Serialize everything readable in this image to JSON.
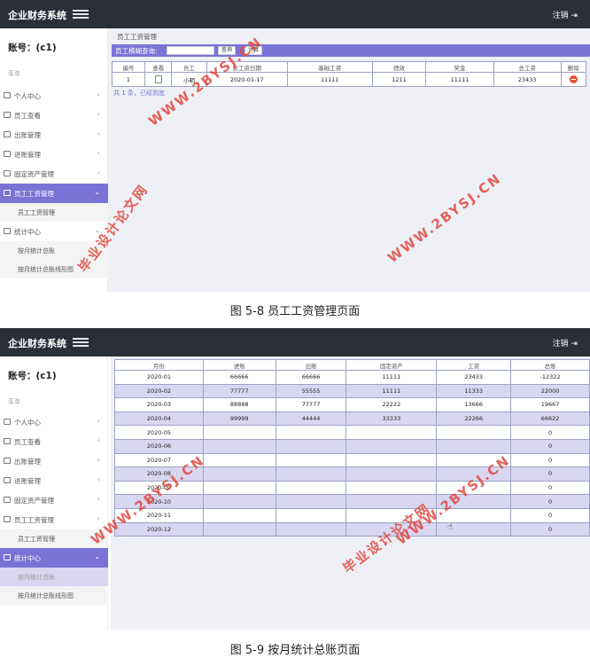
{
  "screenshot1": {
    "brand": "企业财务系统",
    "logout": "注销",
    "account": "账号：(c1)",
    "menu_caption": "菜单",
    "menu": [
      {
        "label": "个人中心",
        "arrow": "‹"
      },
      {
        "label": "员工查看",
        "arrow": "‹"
      },
      {
        "label": "出账管理",
        "arrow": "‹"
      },
      {
        "label": "进账管理",
        "arrow": "‹"
      },
      {
        "label": "固定资产管理",
        "arrow": "‹"
      },
      {
        "label": "员工工资管理",
        "arrow": "⌄"
      },
      {
        "label": "统计中心",
        "arrow": "⌄"
      }
    ],
    "submenu": [
      "员工工资管理",
      "按月统计总账",
      "按月统计总账线形图"
    ],
    "panel_title": "员工工资管理",
    "search_label": "员工模糊查询:",
    "search_button": "查询",
    "reset_button": "计算",
    "columns": [
      "编号",
      "查看",
      "员工",
      "发工资日期",
      "基础工资",
      "绩效",
      "奖金",
      "总工资",
      "删除"
    ],
    "rows": [
      {
        "id": "1",
        "employee": "小明",
        "date": "2020-01-17",
        "base": "11111",
        "perf": "1211",
        "bonus": "11111",
        "total": "23433"
      }
    ],
    "footnote": "共 1 条，已经到底",
    "caption": "图 5-8 员工工资管理页面"
  },
  "screenshot2": {
    "brand": "企业财务系统",
    "logout": "注销",
    "account": "账号：(c1)",
    "menu_caption": "菜单",
    "menu": [
      {
        "label": "个人中心",
        "arrow": "‹"
      },
      {
        "label": "员工查看",
        "arrow": "‹"
      },
      {
        "label": "出账管理",
        "arrow": "‹"
      },
      {
        "label": "进账管理",
        "arrow": "‹"
      },
      {
        "label": "固定资产管理",
        "arrow": "‹"
      },
      {
        "label": "员工工资管理",
        "arrow": "‹"
      },
      {
        "label": "统计中心",
        "arrow": "⌄"
      }
    ],
    "submenu": [
      "员工工资管理",
      "按月统计总账",
      "按月统计总账线形图"
    ],
    "columns": [
      "月份",
      "进账",
      "出账",
      "固定资产",
      "工资",
      "总账"
    ],
    "rows": [
      [
        "2020-01",
        "66666",
        "66666",
        "11111",
        "23433",
        "-12322"
      ],
      [
        "2020-02",
        "77777",
        "55555",
        "11111",
        "11333",
        "22000"
      ],
      [
        "2020-03",
        "88888",
        "77777",
        "22222",
        "13666",
        "19667"
      ],
      [
        "2020-04",
        "99999",
        "44444",
        "33333",
        "22266",
        "66622"
      ],
      [
        "2020-05",
        "",
        "",
        "",
        "",
        "0"
      ],
      [
        "2020-06",
        "",
        "",
        "",
        "",
        "0"
      ],
      [
        "2020-07",
        "",
        "",
        "",
        "",
        "0"
      ],
      [
        "2020-08",
        "",
        "",
        "",
        "",
        "0"
      ],
      [
        "2020-09",
        "",
        "",
        "",
        "",
        "0"
      ],
      [
        "2020-10",
        "",
        "",
        "",
        "",
        "0"
      ],
      [
        "2020-11",
        "",
        "",
        "",
        "",
        "0"
      ],
      [
        "2020-12",
        "",
        "",
        "",
        "",
        "0"
      ]
    ],
    "caption": "图 5-9 按月统计总账页面"
  },
  "watermarks": {
    "url": "WWW.2BYSJ.CN",
    "site": "毕业设计论文网"
  },
  "colors": {
    "topbar": "#2a2f38",
    "accent": "#7b72d6",
    "alt_row": "#d9d6f2",
    "content_bg": "#eef0f6",
    "watermark": "#e2493f"
  }
}
